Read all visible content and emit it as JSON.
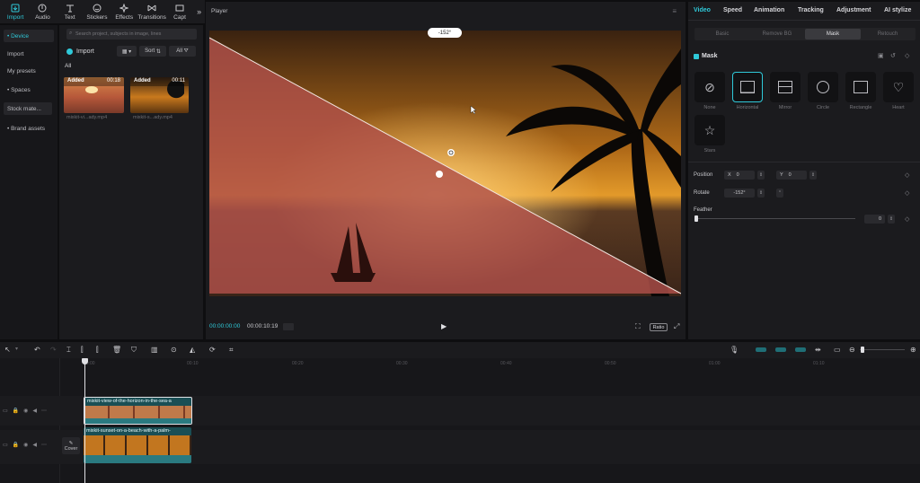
{
  "toolbar": {
    "tabs": [
      {
        "label": "Import",
        "icon": "import-icon"
      },
      {
        "label": "Audio",
        "icon": "audio-icon"
      },
      {
        "label": "Text",
        "icon": "text-icon"
      },
      {
        "label": "Stickers",
        "icon": "sticker-icon"
      },
      {
        "label": "Effects",
        "icon": "effects-icon"
      },
      {
        "label": "Transitions",
        "icon": "transitions-icon"
      },
      {
        "label": "Capt",
        "icon": "captions-icon"
      }
    ],
    "more": "»"
  },
  "leftnav": {
    "items": [
      "• Device",
      "Import",
      "My presets",
      "• Spaces",
      "Stock mate...",
      "• Brand assets"
    ]
  },
  "media": {
    "search_placeholder": "Search project, subjects in image, lines",
    "import_label": "Import",
    "sort_label": "Sort",
    "all_label": "All",
    "section_label": "All",
    "items": [
      {
        "badge": "Added",
        "duration": "00:18",
        "name": "mixkit-vi...ady.mp4"
      },
      {
        "badge": "Added",
        "duration": "00:11",
        "name": "mixkit-s...ady.mp4"
      }
    ]
  },
  "player": {
    "title": "Player",
    "rotation_badge": "-152°",
    "current_time": "00:00:00:00",
    "total_time": "00:00:10:19",
    "ratio_label": "Ratio"
  },
  "inspector": {
    "tabs": [
      "Video",
      "Speed",
      "Animation",
      "Tracking",
      "Adjustment",
      "AI stylize"
    ],
    "subtabs": [
      "Basic",
      "Remove BG",
      "Mask",
      "Retouch"
    ],
    "section_title": "Mask",
    "shapes": [
      "None",
      "Horizontal",
      "Mirror",
      "Circle",
      "Rectangle",
      "Heart",
      "Stars"
    ],
    "position_label": "Position",
    "x_label": "X",
    "x_value": "0",
    "y_label": "Y",
    "y_value": "0",
    "rotate_label": "Rotate",
    "rotate_value": "-152°",
    "feather_label": "Feather",
    "feather_value": "0",
    "feather_level": 0
  },
  "timeline": {
    "ticks": [
      "00:00",
      "00:10",
      "00:20",
      "00:30",
      "00:40",
      "00:50",
      "01:00",
      "01:10"
    ],
    "cover_label": "Cover",
    "clip1_name": "mixkit-view-of-the-horizon-in-the-sea-a",
    "clip2_name": "mixkit-sunset-on-a-beach-with-a-palm-"
  },
  "colors": {
    "accent": "#2fc9d9",
    "panel": "#1b1b1e",
    "mask_overlay": "#b0504a"
  }
}
